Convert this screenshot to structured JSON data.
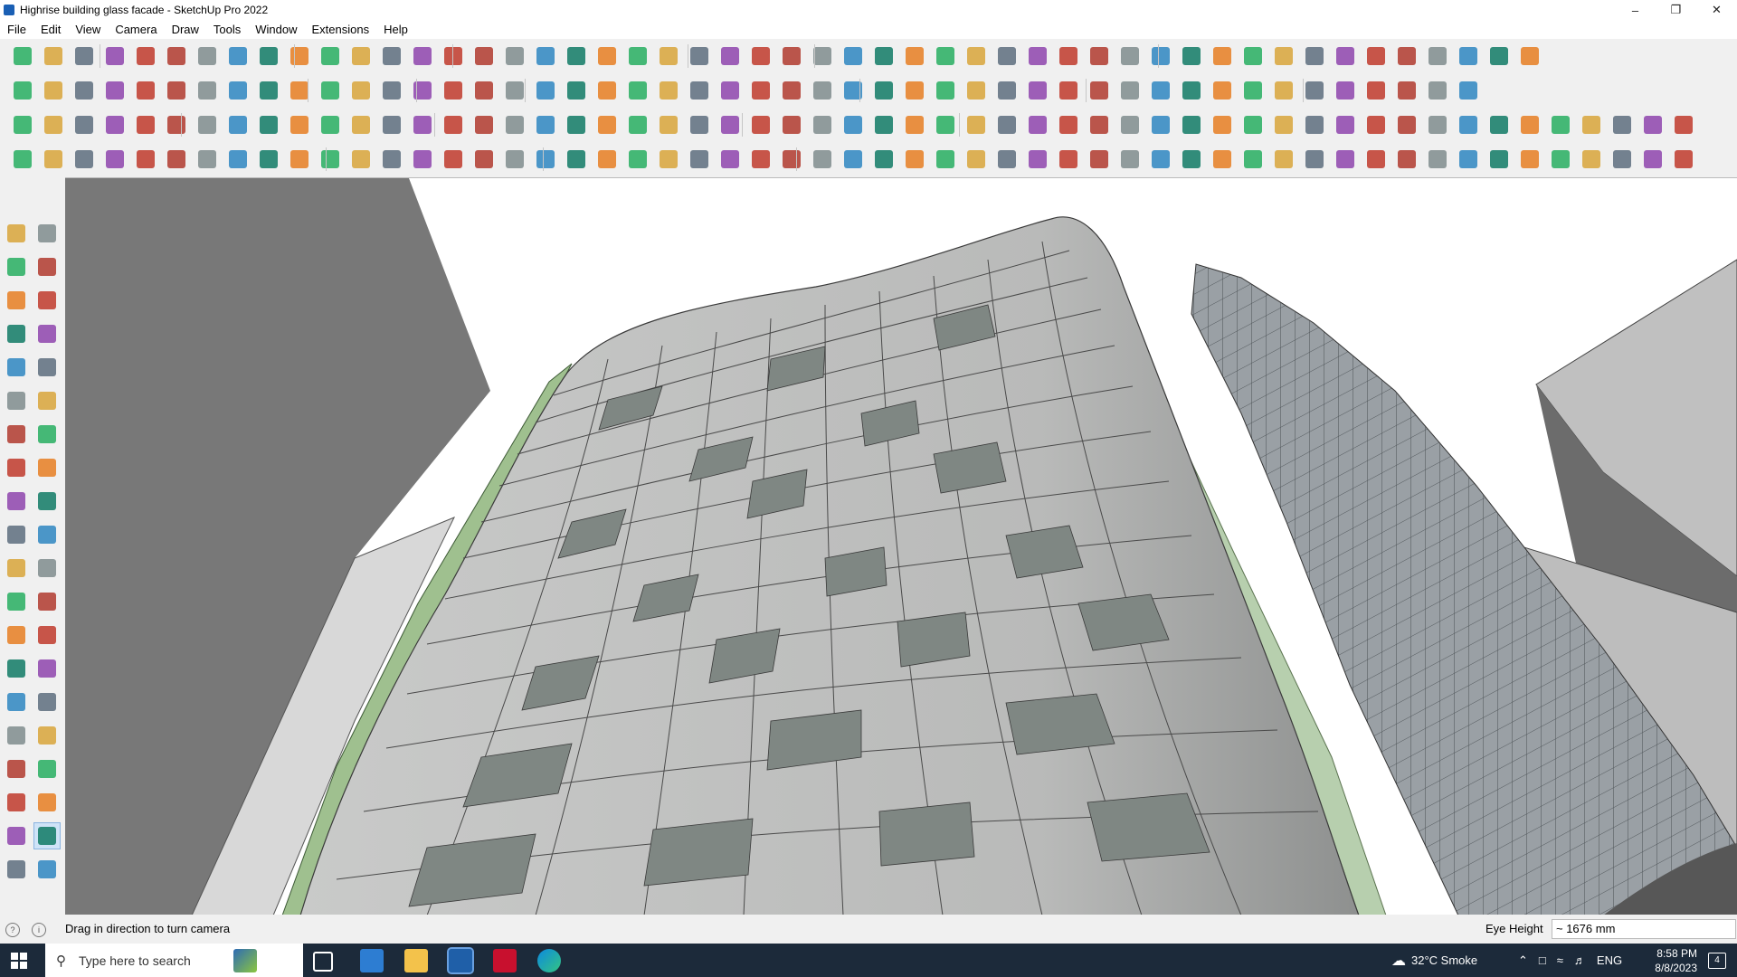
{
  "window": {
    "title": "Highrise building glass facade - SketchUp Pro 2022",
    "minimize": "–",
    "maximize": "❐",
    "close": "✕"
  },
  "menu": [
    "File",
    "Edit",
    "View",
    "Camera",
    "Draw",
    "Tools",
    "Window",
    "Extensions",
    "Help"
  ],
  "status": {
    "message": "Drag in direction to turn camera",
    "measure_label": "Eye Height",
    "measure_value": "~ 1676 mm"
  },
  "taskbar": {
    "search_placeholder": "Type here to search",
    "weather": "32°C  Smoke",
    "language": "ENG",
    "time": "8:58 PM",
    "date": "8/8/2023",
    "notification_count": "4"
  },
  "colors": {
    "facade": "#a9aaa9",
    "facade_dark": "#7f8783",
    "glass_green": "#9fc08f",
    "side_tower": "#8c9196",
    "ground_shadow": "#6e6e6e",
    "active_tool": "#cfe3f7"
  }
}
